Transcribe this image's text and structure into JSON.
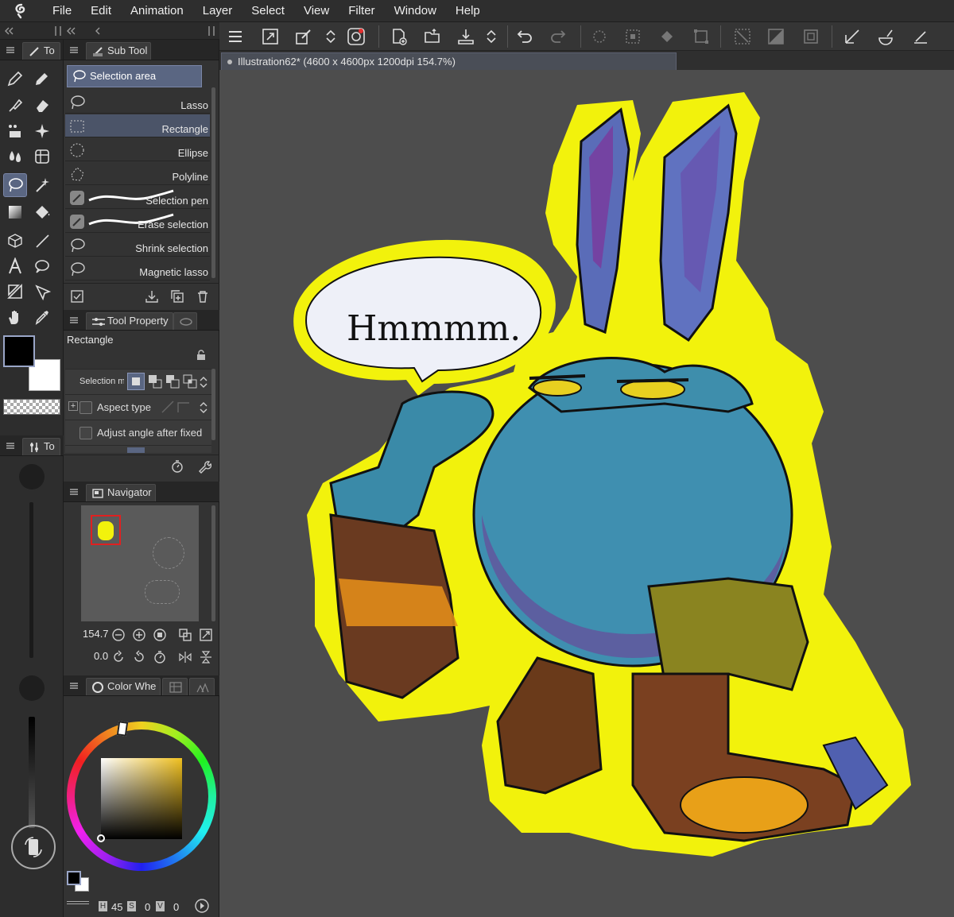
{
  "menu": [
    "File",
    "Edit",
    "Animation",
    "Layer",
    "Select",
    "View",
    "Filter",
    "Window",
    "Help"
  ],
  "tool_panel": {
    "tab_label": "To",
    "tab2_label": "To"
  },
  "sub_tool": {
    "panel_label": "Sub Tool",
    "group_label": "Selection area",
    "items": [
      {
        "label": "Lasso",
        "icon": "lasso-icon"
      },
      {
        "label": "Rectangle",
        "icon": "rectangle-select-icon"
      },
      {
        "label": "Ellipse",
        "icon": "ellipse-select-icon"
      },
      {
        "label": "Polyline",
        "icon": "polyline-select-icon"
      },
      {
        "label": "Selection pen",
        "icon": "selection-pen-icon"
      },
      {
        "label": "Erase selection",
        "icon": "erase-selection-icon"
      },
      {
        "label": "Shrink selection",
        "icon": "shrink-selection-icon"
      },
      {
        "label": "Magnetic lasso",
        "icon": "magnetic-lasso-icon"
      }
    ],
    "selected": "Rectangle"
  },
  "tool_property": {
    "panel_label": "Tool Property",
    "tool_name": "Rectangle",
    "selection_mode_label": "Selection mc",
    "aspect_type_label": "Aspect type",
    "adjust_angle_label": "Adjust angle after fixed"
  },
  "navigator": {
    "panel_label": "Navigator",
    "zoom": "154.7",
    "rotation": "0.0"
  },
  "color": {
    "panel_label": "Color Whe",
    "h_label": "H",
    "h_value": "45",
    "s_label": "S",
    "s_value": "0",
    "v_label": "V",
    "v_value": "0",
    "main_color": "#000000",
    "sub_color": "#ffffff"
  },
  "document": {
    "tab_title": "Illustration62* (4600 x 4600px 1200dpi 154.7%)"
  },
  "artwork": {
    "speech_text": "Hmmmm."
  },
  "colors": {
    "accent": "#5a6682",
    "outline": "#f2f20c",
    "canvas_bg": "#4d4d4d"
  }
}
